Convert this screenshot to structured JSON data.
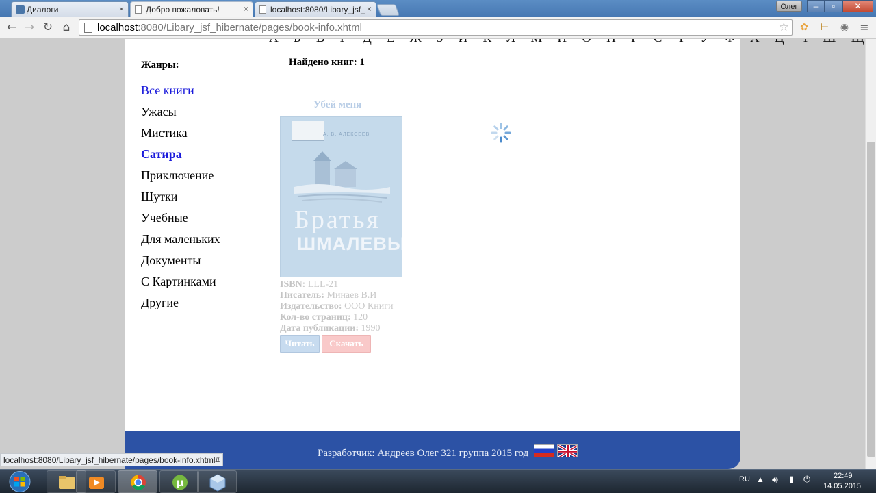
{
  "browser": {
    "tabs": [
      {
        "label": "Диалоги",
        "close": "×"
      },
      {
        "label": "Добро пожаловать!",
        "close": "×"
      },
      {
        "label": "localhost:8080/Libary_jsf_",
        "close": "×"
      }
    ],
    "user": "Олег",
    "window_controls": {
      "minimize": "–",
      "maximize": "▫",
      "close": "✕"
    },
    "url_host": "localhost",
    "url_rest": ":8080/Libary_jsf_hibernate/pages/book-info.xhtml"
  },
  "page": {
    "alphabet": "А Б В Г Д Е Ж З И К Л М Н О П Р С Т У Ф Х Ц Ч Ш Щ Э Ю Я",
    "sidebar": {
      "title": "Жанры:",
      "genres": [
        "Все книги",
        "Ужасы",
        "Мистика",
        "Сатира",
        "Приключение",
        "Шутки",
        "Учебные",
        "Для маленьких",
        "Документы",
        "С Картинками",
        "Другие"
      ]
    },
    "found_label": "Найдено книг: 1",
    "book": {
      "title": "Убей меня",
      "cover_author": "А. В. АЛЕКСЕЕВ",
      "cover_title1": "Братья",
      "cover_title2": "ШМАЛЕВЫ",
      "isbn_label": "ISBN:",
      "isbn": "LLL-21",
      "writer_label": "Писатель:",
      "writer": "Минаев В.И",
      "publisher_label": "Издательство:",
      "publisher": "ООО Книги",
      "pages_label": "Кол-во страниц:",
      "pages": "120",
      "date_label": "Дата публикации:",
      "date": "1990",
      "read_button": "Читать",
      "download_button": "Скачать"
    },
    "footer_text": "Разработчик: Андреев Олег 321 группа 2015 год"
  },
  "status_url": "localhost:8080/Libary_jsf_hibernate/pages/book-info.xhtml#",
  "taskbar": {
    "language": "RU",
    "time": "22:49",
    "date": "14.05.2015"
  },
  "colors": {
    "footer": "#2c52a5",
    "link": "#1a1adb",
    "read_button": "#c7dbef",
    "download_button": "#f9c9c9"
  }
}
